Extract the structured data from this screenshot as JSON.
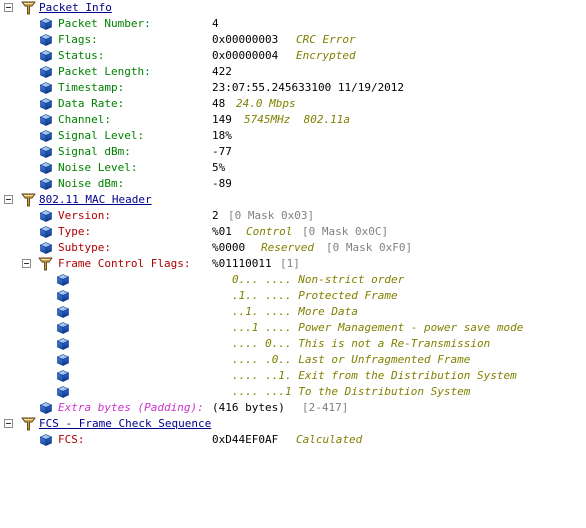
{
  "sections": {
    "packet_info": {
      "title": "Packet Info",
      "fields": [
        {
          "label": "Packet Number:",
          "value": "4",
          "note": ""
        },
        {
          "label": "Flags:",
          "value": "0x00000003",
          "note": "CRC Error"
        },
        {
          "label": "Status:",
          "value": "0x00000004",
          "note": "Encrypted"
        },
        {
          "label": "Packet Length:",
          "value": "422",
          "note": ""
        },
        {
          "label": "Timestamp:",
          "value": "23:07:55.245633100 11/19/2012",
          "note": ""
        },
        {
          "label": "Data Rate:",
          "value": "48",
          "note": "24.0 Mbps"
        },
        {
          "label": "Channel:",
          "value": "149",
          "note": "5745MHz  802.11a"
        },
        {
          "label": "Signal Level:",
          "value": "18%",
          "note": ""
        },
        {
          "label": "Signal dBm:",
          "value": "-77",
          "note": ""
        },
        {
          "label": "Noise Level:",
          "value": "5%",
          "note": ""
        },
        {
          "label": "Noise dBm:",
          "value": "-89",
          "note": ""
        }
      ]
    },
    "mac_header": {
      "title": "802.11 MAC Header",
      "version": {
        "label": "Version:",
        "value": "2",
        "mask": "[0 Mask 0x03]"
      },
      "type": {
        "label": "Type:",
        "value": "%01",
        "note": "Control",
        "mask": "[0 Mask 0x0C]"
      },
      "subtype": {
        "label": "Subtype:",
        "value": "%0000",
        "note": "Reserved",
        "mask": "[0 Mask 0xF0]"
      },
      "frame_control": {
        "label": "Frame Control Flags:",
        "value": "%01110011",
        "mask": "[1]",
        "bits": [
          "0... .... Non-strict order",
          ".1.. .... Protected Frame",
          "..1. .... More Data",
          "...1 .... Power Management - power save mode",
          ".... 0... This is not a Re-Transmission",
          ".... .0.. Last or Unfragmented Frame",
          ".... ..1. Exit from the Distribution System",
          ".... ...1 To the Distribution System"
        ]
      },
      "extra": {
        "label": "Extra bytes (Padding):",
        "value": "(416 bytes)",
        "mask": "[2-417]"
      }
    },
    "fcs": {
      "title": "FCS - Frame Check Sequence",
      "field": {
        "label": "FCS:",
        "value": "0xD44EF0AF",
        "note": "Calculated"
      }
    }
  },
  "colors": {
    "section_title": "#00008b",
    "field_green": "#008000",
    "field_red": "#b00000",
    "note": "#808000",
    "mask": "#808080",
    "padding": "#cc33cc"
  }
}
